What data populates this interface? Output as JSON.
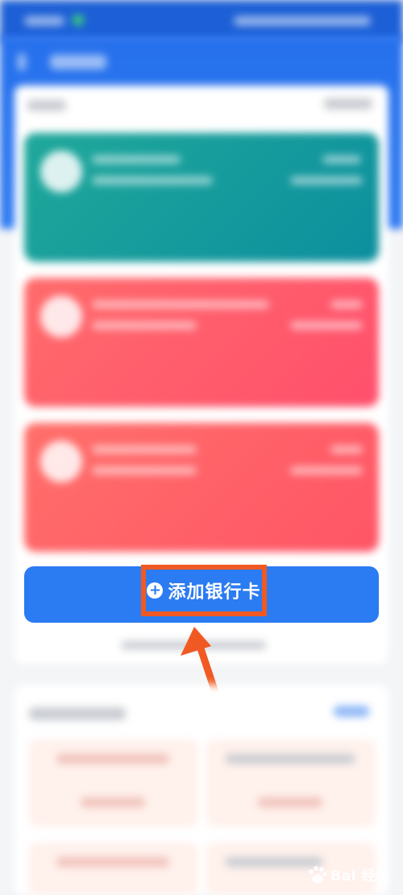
{
  "add_card": {
    "label": "添加银行卡",
    "icon": "plus-circle-icon"
  },
  "watermark": {
    "text": "Bai 经验"
  },
  "colors": {
    "header_blue": "#2670ec",
    "button_blue": "#2b7bf2",
    "highlight_orange": "#f05a22",
    "card_teal": "#1fa89a",
    "card_red": "#ff5566"
  }
}
